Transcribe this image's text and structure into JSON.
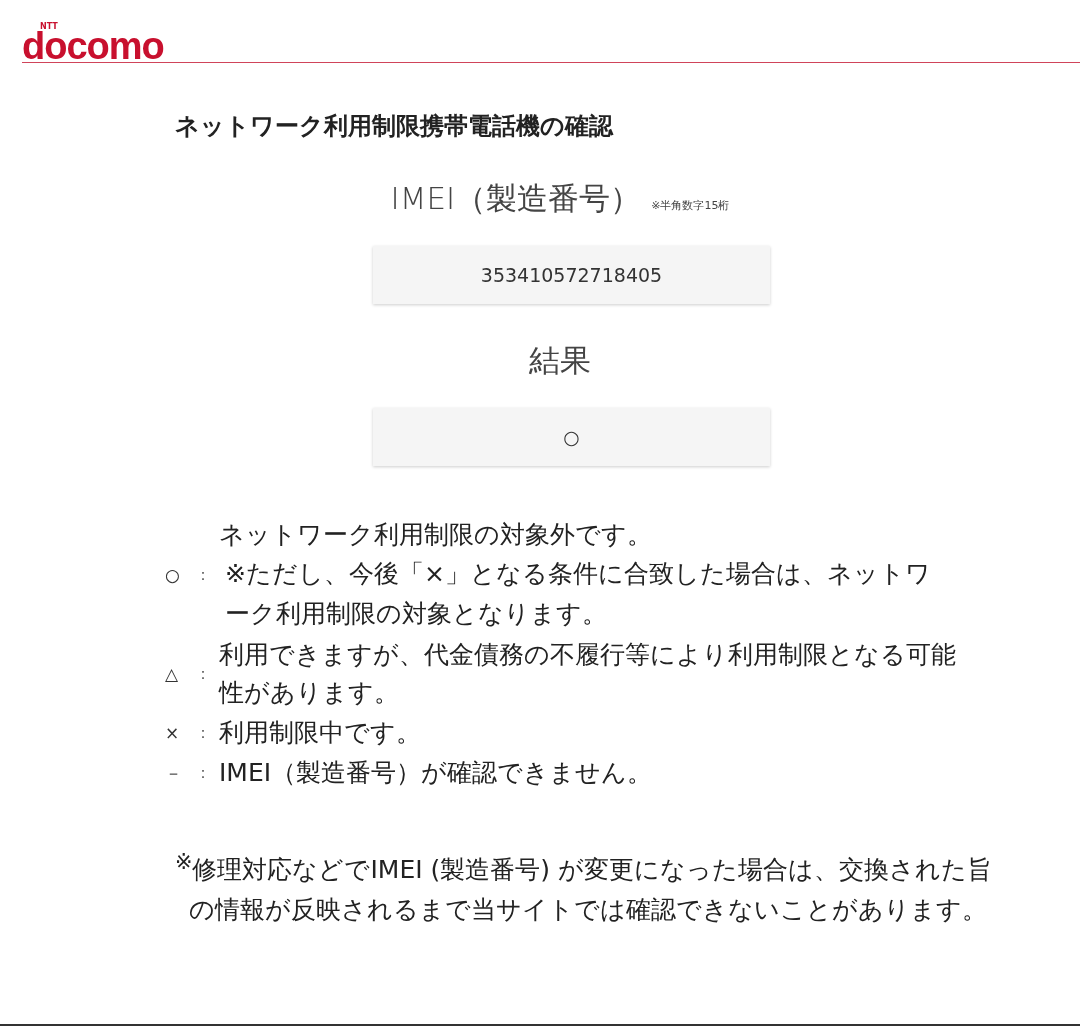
{
  "header": {
    "logo_small": "NTT",
    "logo": "docomo"
  },
  "title": "ネットワーク利用制限携帯電話機の確認",
  "imei": {
    "label": "IMEI（製造番号）",
    "hint": "※半角数字15桁",
    "value": "353410572718405"
  },
  "result": {
    "label": "結果",
    "value": "○"
  },
  "legend": [
    {
      "symbol": "○",
      "text": "ネットワーク利用制限の対象外です。",
      "note": "※ただし、今後「×」となる条件に合致した場合は、ネットワーク利用制限の対象となります。"
    },
    {
      "symbol": "△",
      "text": "利用できますが、代金債務の不履行等により利用制限となる可能性があります。"
    },
    {
      "symbol": "×",
      "text": "利用制限中です。"
    },
    {
      "symbol": "－",
      "text": "IMEI（製造番号）が確認できません。"
    }
  ],
  "separator": "：",
  "footnote": "$^{※}$修理対応などでIMEI (製造番号) が変更になった場合は、交換された旨の情報が反映されるまで当サイトでは確認できないことがあります。"
}
